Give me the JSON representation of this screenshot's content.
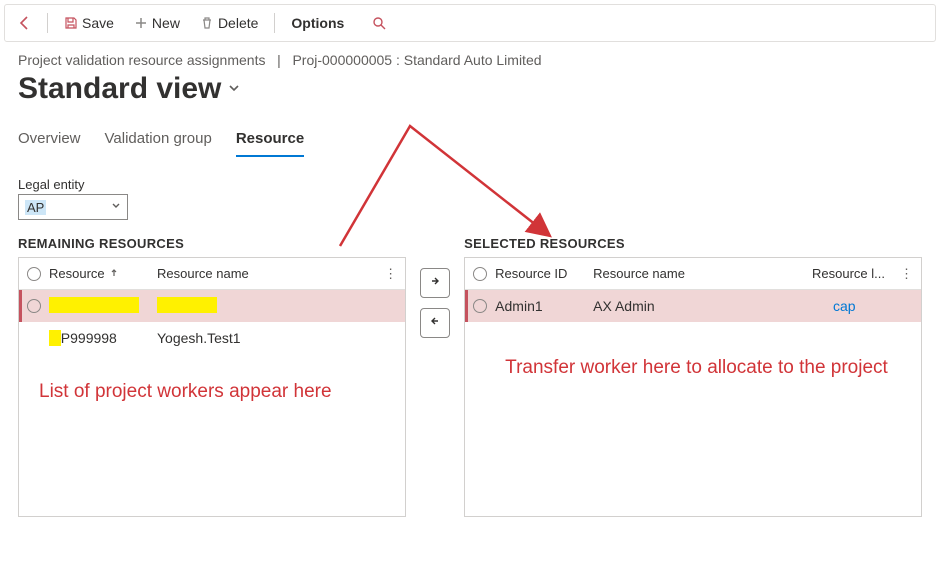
{
  "toolbar": {
    "save_label": "Save",
    "new_label": "New",
    "delete_label": "Delete",
    "options_label": "Options"
  },
  "breadcrumb": {
    "module": "Project validation resource assignments",
    "separator": "|",
    "context": "Proj-000000005 : Standard Auto Limited"
  },
  "view": {
    "title": "Standard view"
  },
  "tabs": {
    "overview": "Overview",
    "validation_group": "Validation group",
    "resource": "Resource"
  },
  "legal_entity": {
    "label": "Legal entity",
    "value": "AP"
  },
  "panels": {
    "remaining": {
      "title": "REMAINING RESOURCES",
      "col_resource": "Resource",
      "col_resname": "Resource name",
      "rows": [
        {
          "resource": "",
          "name": ""
        },
        {
          "resource": "P999998",
          "name": "Yogesh.Test1"
        }
      ],
      "annotation": "List of project workers appear here"
    },
    "selected": {
      "title": "SELECTED RESOURCES",
      "col_rid": "Resource ID",
      "col_resname": "Resource name",
      "col_legal": "Resource l...",
      "rows": [
        {
          "rid": "Admin1",
          "name": "AX Admin",
          "legal": "cap"
        }
      ],
      "annotation": "Transfer worker here to allocate to the project"
    }
  },
  "icons": {
    "back": "back-arrow-icon",
    "save": "save-disk-icon",
    "new": "plus-icon",
    "delete": "trash-icon",
    "search": "search-icon",
    "sort": "sort-asc-icon",
    "more": "more-vertical-icon",
    "chevron_down": "chevron-down-icon",
    "move_right": "arrow-right-icon",
    "move_left": "arrow-left-icon"
  },
  "colors": {
    "accent": "#0078d4",
    "danger": "#d13438",
    "highlight": "#fff100"
  }
}
